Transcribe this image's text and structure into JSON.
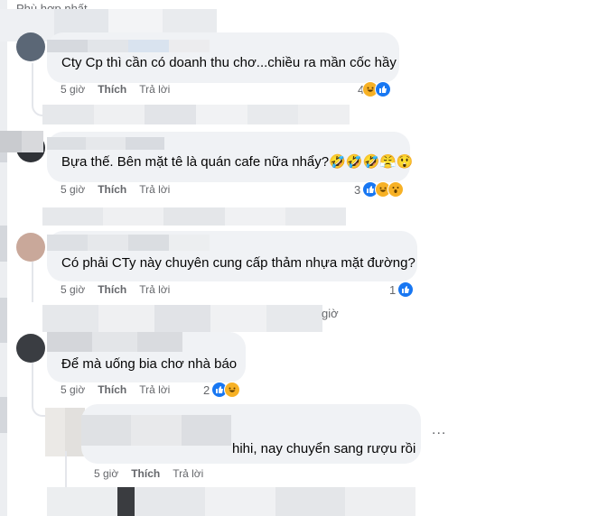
{
  "header": {
    "sort_label": "Phù hợp nhất"
  },
  "colors": {
    "bubble_bg": "#f0f2f5",
    "meta_gray": "#65676b",
    "like_blue": "#1877f2",
    "haha_yellow": "#f7b125"
  },
  "comments": [
    {
      "text": "Cty Cp thì cần có doanh thu chơ...chiều ra mần cốc hầy",
      "time": "5 giờ",
      "like": "Thích",
      "reply": "Trả lời",
      "reaction_count": "4",
      "reactions": [
        "like-icon",
        "haha-icon"
      ]
    },
    {
      "text": "Bựa thế. Bên mặt tê là quán cafe nữa nhẩy?🤣🤣🤣😤😲",
      "time": "5 giờ",
      "like": "Thích",
      "reply": "Trả lời",
      "reaction_count": "3",
      "reactions": [
        "like-icon",
        "haha-icon",
        "wow-icon"
      ]
    },
    {
      "text": "Có phải CTy này chuyên cung cấp thảm nhựa mặt đường?",
      "time": "5 giờ",
      "like": "Thích",
      "reply": "Trả lời",
      "reaction_count": "1",
      "reactions": [
        "like-icon"
      ]
    },
    {
      "text": "Để mà uống bia chơ nhà báo",
      "time": "5 giờ",
      "like": "Thích",
      "reply": "Trả lời",
      "reaction_count": "2",
      "reactions": [
        "like-icon",
        "haha-icon"
      ]
    }
  ],
  "reply": {
    "text": "hihi, nay chuyển sang rượu rồi",
    "time": "5 giờ",
    "like": "Thích",
    "reply": "Trả lời",
    "more": "..."
  },
  "partial_time": "giờ"
}
